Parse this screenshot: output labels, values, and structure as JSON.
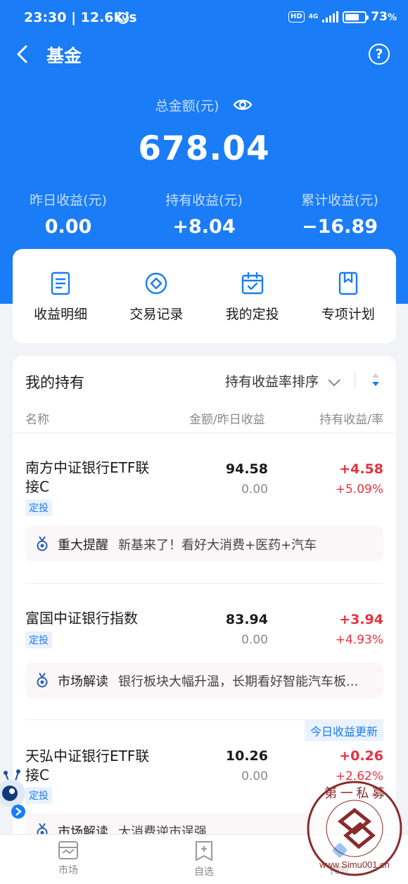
{
  "status": {
    "time": "23:30 | 12.6K/s",
    "battery": "73",
    "battery_unit": "%",
    "hd": "HD",
    "network": "4G"
  },
  "nav": {
    "title": "基金"
  },
  "summary": {
    "total_label": "总金额(元)",
    "total_amount": "678.04",
    "metrics": [
      {
        "label": "昨日收益(元)",
        "value": "0.00"
      },
      {
        "label": "持有收益(元)",
        "value": "+8.04"
      },
      {
        "label": "累计收益(元)",
        "value": "−16.89"
      }
    ]
  },
  "actions": [
    {
      "label": "收益明细",
      "icon": "document-icon"
    },
    {
      "label": "交易记录",
      "icon": "coin-icon"
    },
    {
      "label": "我的定投",
      "icon": "calendar-check-icon"
    },
    {
      "label": "专项计划",
      "icon": "bookmark-icon"
    }
  ],
  "holdings": {
    "title": "我的持有",
    "sort_label": "持有收益率排序",
    "columns": {
      "name": "名称",
      "amount": "金额/昨日收益",
      "gain": "持有收益/率"
    },
    "funds": [
      {
        "name_line1": "南方中证银行ETF联",
        "name_line2": "接C",
        "tag": "定投",
        "amount": "94.58",
        "yesterday": "0.00",
        "gain": "+4.58",
        "gain_rate": "+5.09%",
        "notice_title": "重大提醒",
        "notice_text": "新基来了！看好大消费+医药+汽车"
      },
      {
        "name_line1": "富国中证银行指数",
        "tag": "定投",
        "amount": "83.94",
        "yesterday": "0.00",
        "gain": "+3.94",
        "gain_rate": "+4.93%",
        "notice_title": "市场解读",
        "notice_text": "银行板块大幅升温，长期看好智能汽车板..."
      },
      {
        "name_line1": "天弘中证银行ETF联",
        "name_line2": "接C",
        "tag": "定投",
        "badge": "今日收益更新",
        "amount": "10.26",
        "yesterday": "0.00",
        "gain": "+0.26",
        "gain_rate": "+2.62%",
        "notice_title": "市场解读",
        "notice_text": "大消费逆市逞强"
      }
    ]
  },
  "tabbar": [
    {
      "label": "市场"
    },
    {
      "label": "自选"
    },
    {
      "label": "持有"
    }
  ],
  "watermark": {
    "text": "第一私募",
    "url": "www.Simu001.cn"
  }
}
